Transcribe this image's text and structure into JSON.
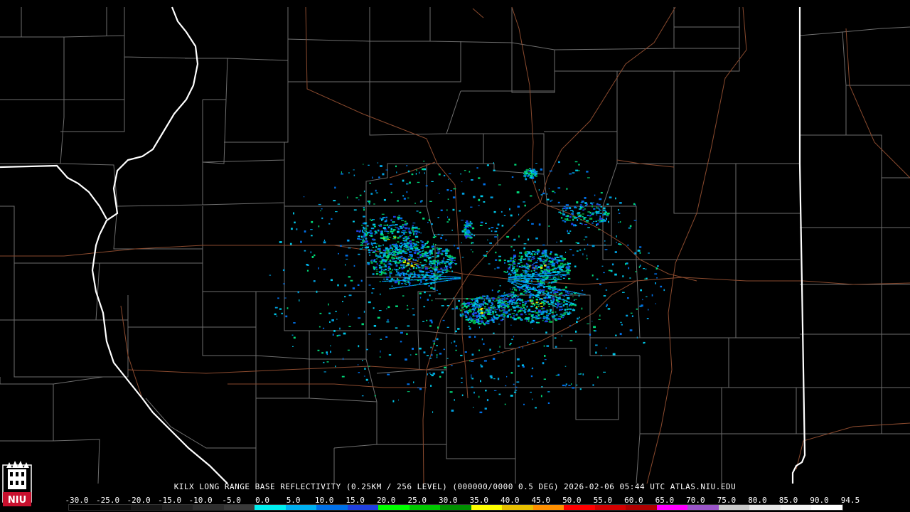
{
  "caption": "KILX LONG RANGE BASE REFLECTIVITY (0.25KM / 256 LEVEL) (000000/0000 0.5 DEG) 2026-02-06 05:44 UTC  ATLAS.NIU.EDU",
  "logo_text": "NIU",
  "colors": {
    "background": "#000000",
    "county_lines": "#6e6e6e",
    "state_lines": "#ffffff",
    "highways": "#8a4a2e",
    "logo_red": "#c8102e"
  },
  "color_scale": {
    "labels": [
      "-30.0",
      "-25.0",
      "-20.0",
      "-15.0",
      "-10.0",
      "-5.0",
      "0.0",
      "5.0",
      "10.0",
      "15.0",
      "20.0",
      "25.0",
      "30.0",
      "35.0",
      "40.0",
      "45.0",
      "50.0",
      "55.0",
      "60.0",
      "65.0",
      "70.0",
      "75.0",
      "80.0",
      "85.0",
      "90.0",
      "94.5"
    ],
    "colors": [
      "#000000",
      "#0b0b0b",
      "#161616",
      "#222222",
      "#2e2e2e",
      "#3a3a3a",
      "#00eeee",
      "#00b0f0",
      "#0070e8",
      "#2040e0",
      "#00ff00",
      "#00c800",
      "#009000",
      "#ffff00",
      "#e8c000",
      "#ff9000",
      "#ff0000",
      "#d40000",
      "#b00000",
      "#ff00ff",
      "#9a55c8",
      "#c8c8c8",
      "#e6e6e6",
      "#f4f4f4",
      "#ffffff"
    ]
  }
}
